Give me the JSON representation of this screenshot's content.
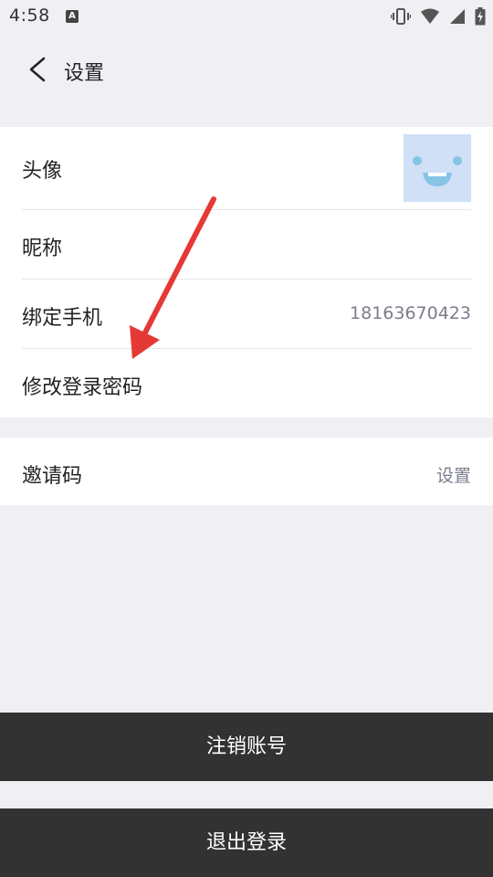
{
  "status_bar": {
    "time": "4:58",
    "notification_icon": "a-icon",
    "icons": [
      "vibrate-icon",
      "wifi-icon",
      "signal-icon",
      "battery-charging-icon"
    ]
  },
  "header": {
    "title": "设置",
    "back_icon": "chevron-left-icon"
  },
  "profile_group": {
    "avatar_label": "头像",
    "nickname_label": "昵称",
    "phone_label": "绑定手机",
    "phone_value": "18163670423",
    "password_label": "修改登录密码"
  },
  "invite_group": {
    "label": "邀请码",
    "value": "设置"
  },
  "buttons": {
    "cancel_account": "注销账号",
    "logout": "退出登录"
  },
  "colors": {
    "background": "#efeff4",
    "card": "#ffffff",
    "button_dark": "#323232",
    "secondary_text": "#7a7d8c",
    "avatar_bg": "#cfe0f7",
    "avatar_face": "#86c4e6",
    "annotation_arrow": "#e53935"
  }
}
